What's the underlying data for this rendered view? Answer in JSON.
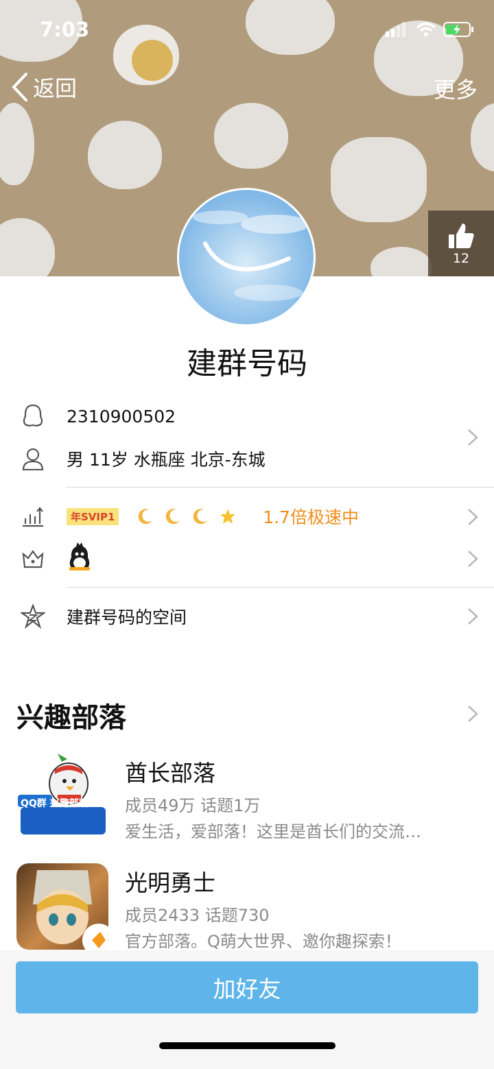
{
  "status_bar": {
    "time": "7:03"
  },
  "nav": {
    "back_label": "返回",
    "more_label": "更多"
  },
  "like": {
    "count": "12"
  },
  "profile": {
    "name": "建群号码",
    "qq_number": "2310900502",
    "info": "男 11岁 水瓶座 北京-东城",
    "vip_badge": "年SVIP1",
    "speed_text": "1.7倍极速中",
    "space_label": "建群号码的空间"
  },
  "tribes": {
    "title": "兴趣部落",
    "items": [
      {
        "name": "酋长部落",
        "stats": "成员49万 话题1万",
        "desc": "爱生活，爱部落！这里是酋长们的交流…",
        "thumb_text": "QQ群 兴趣部落"
      },
      {
        "name": "光明勇士",
        "stats": "成员2433 话题730",
        "desc": "官方部落。Q萌大世界、邀你趣探索！"
      }
    ]
  },
  "actions": {
    "add_friend_label": "加好友"
  },
  "colors": {
    "header_bg": "#b09c7c",
    "button_bg": "#5fb5e9",
    "speed_orange": "#f08e1d"
  }
}
